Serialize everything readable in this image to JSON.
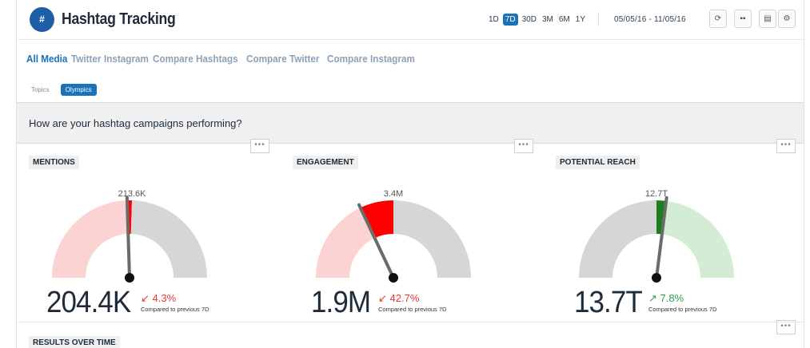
{
  "header": {
    "logo_glyph": "#",
    "title": "Hashtag Tracking",
    "ranges": [
      "1D",
      "7D",
      "30D",
      "3M",
      "6M",
      "1Y"
    ],
    "active_range": "7D",
    "date_range": "05/05/16 - 11/05/16",
    "buttons": [
      "refresh-icon",
      "grid-icon",
      "export-icon",
      "settings-icon"
    ]
  },
  "nav": {
    "links": [
      "All Media",
      "Twitter",
      "Instagram",
      "Compare Hashtags",
      "Compare Twitter",
      "Compare Instagram"
    ],
    "active": "All Media"
  },
  "chips": {
    "topics": "Topics",
    "selected": "Olympics"
  },
  "question": "How are your hashtag campaigns performing?",
  "more_label": "•••",
  "cards": [
    {
      "title": "MENTIONS",
      "previous": "213.6K",
      "value": "204.4K",
      "delta": "4.3%",
      "direction": "down",
      "compare": "Compared to previous 7D",
      "fraction": 0.49,
      "prev_fraction": 0.51
    },
    {
      "title": "ENGAGEMENT",
      "previous": "3.4M",
      "value": "1.9M",
      "delta": "42.7%",
      "direction": "down",
      "compare": "Compared to previous 7D",
      "fraction": 0.36,
      "prev_fraction": 0.5
    },
    {
      "title": "POTENTIAL REACH",
      "previous": "12.7T",
      "value": "13.7T",
      "delta": "7.8%",
      "direction": "up",
      "compare": "Compared to previous 7D",
      "fraction": 0.54,
      "prev_fraction": 0.5
    }
  ],
  "results_title": "RESULTS OVER TIME",
  "colors": {
    "accent": "#1a73b8",
    "down": "#e53935",
    "up": "#2e9e4a",
    "down_fill": "#fcd3d3",
    "up_fill": "#d4ecd4",
    "neutral": "#d6d6d6",
    "down_strong": "#ff0000",
    "up_strong": "#1e7e1e"
  }
}
